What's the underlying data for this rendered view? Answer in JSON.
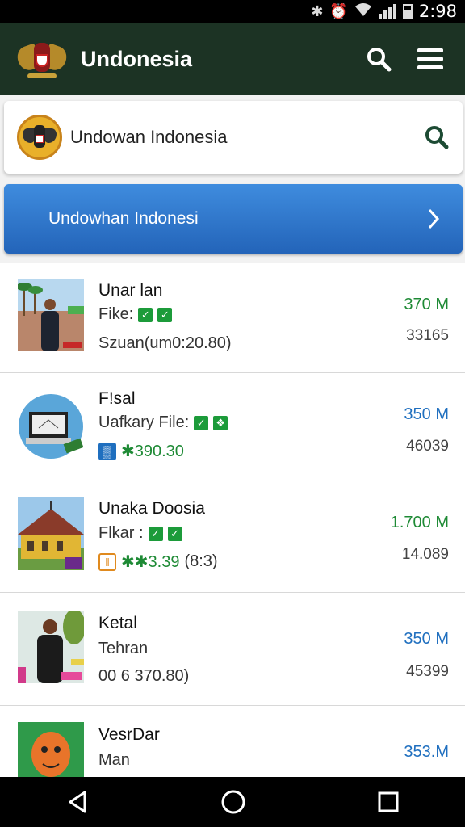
{
  "status": {
    "time": "2:98"
  },
  "app": {
    "title": "Undonesia"
  },
  "search": {
    "text": "Undowan Indonesia"
  },
  "banner": {
    "label": "Undowhan Indonesi"
  },
  "rows": [
    {
      "title": "Unar lan",
      "sub": "Fike:",
      "line3": "Szuan(um0:20.80)",
      "size": "370 M",
      "size_color": "#1e8a35",
      "count": "33165"
    },
    {
      "title": "F!sal",
      "sub": "Uafkary File:",
      "line3": "✱390.30",
      "size": "350 M",
      "size_color": "#1f6fbf",
      "count": "46039"
    },
    {
      "title": "Unaka Doosia",
      "sub": "Flkar :",
      "line3": "✱✱3.39",
      "line3b": "(8:3)",
      "size": "1.700 M",
      "size_color": "#1e8a35",
      "count": "14.089"
    },
    {
      "title": "Ketal",
      "sub": "Tehran",
      "line3": "00 6 370.80)",
      "size": "350 M",
      "size_color": "#1f6fbf",
      "count": "45399"
    },
    {
      "title": "VesrDar",
      "sub": "Man",
      "size": "353.M",
      "size_color": "#1f6fbf"
    }
  ]
}
